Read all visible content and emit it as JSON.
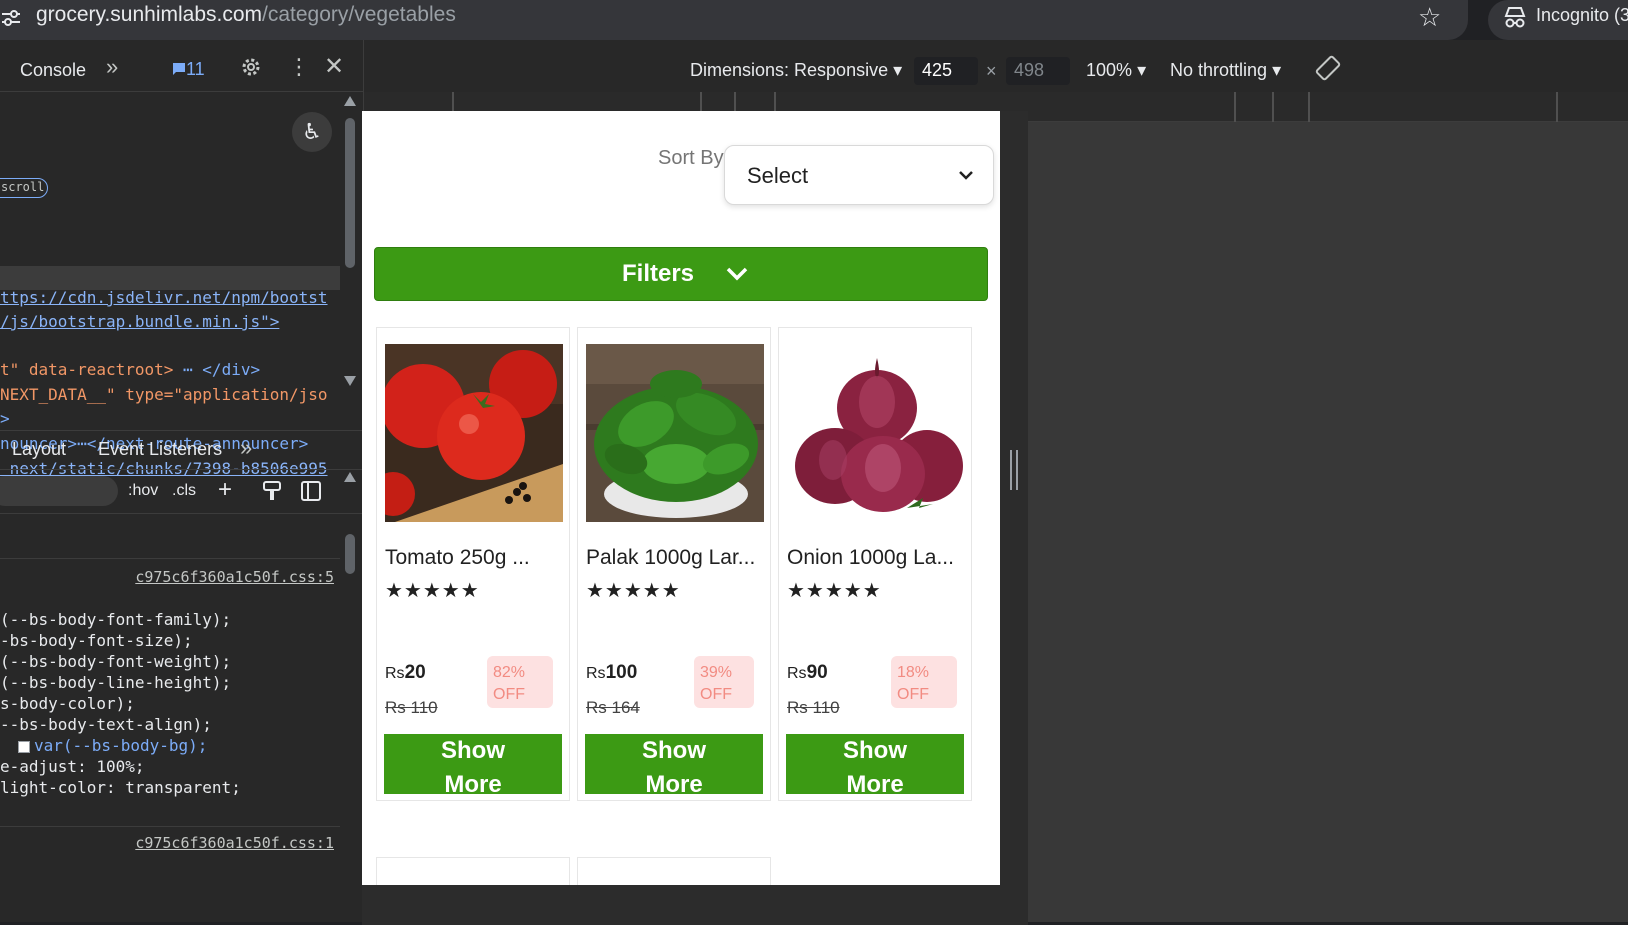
{
  "browser": {
    "url_host": "grocery.sunhimlabs.com",
    "url_path": "/category/vegetables",
    "incognito_label": "Incognito (3"
  },
  "devtools": {
    "console_tab": "Console",
    "message_count": "11",
    "elements_lines": [
      {
        "text": "ttps://cdn.jsdelivr.net/npm/bootst",
        "kind": "link"
      },
      {
        "text": "/js/bootstrap.bundle.min.js\">",
        "kind": "link"
      },
      {
        "text": "t\" data-reactroot>",
        "kind": "blue",
        "tail": "</div>"
      },
      {
        "text": "NEXT_DATA__\" type=\"application/jso",
        "kind": "orange"
      },
      {
        "text": ">",
        "kind": "blue"
      },
      {
        "text": "nouncer>",
        "kind": "blue",
        "tail": "</next-route-announcer>"
      },
      {
        "text": "_next/static/chunks/7398-b8506e995",
        "kind": "link"
      }
    ],
    "scroll_badge": "scroll",
    "styles_tabs": [
      "Layout",
      "Event Listeners"
    ],
    "hov": ":hov",
    "cls": ".cls",
    "css_source_1": "c975c6f360a1c50f.css:5",
    "css_lines": [
      {
        "text": "(--bs-body-font-family);"
      },
      {
        "text": "-bs-body-font-size);"
      },
      {
        "text": "(--bs-body-font-weight);"
      },
      {
        "text": "(--bs-body-line-height);"
      },
      {
        "text": "s-body-color);"
      },
      {
        "text": "--bs-body-text-align);"
      },
      {
        "text": "var(--bs-body-bg);"
      },
      {
        "text": "e-adjust: 100%;"
      },
      {
        "text": "light-color: transparent;"
      }
    ],
    "css_source_2": "c975c6f360a1c50f.css:1"
  },
  "device_toolbar": {
    "dimensions_label": "Dimensions: Responsive",
    "width": "425",
    "height": "498",
    "zoom": "100%",
    "throttling": "No throttling"
  },
  "page": {
    "sort_label": "Sort By",
    "sort_value": "Select",
    "filters_label": "Filters",
    "brand_green": "#3c9a14",
    "products": [
      {
        "name": "Tomato 250g ...",
        "stars": "★★★★★",
        "price_cur": "Rs",
        "price": "20",
        "mrp": "Rs 110",
        "discount_pct": "82%",
        "discount_off": "OFF",
        "image": "tomato-image"
      },
      {
        "name": "Palak 1000g Lar...",
        "stars": "★★★★★",
        "price_cur": "Rs",
        "price": "100",
        "mrp": "Rs 164",
        "discount_pct": "39%",
        "discount_off": "OFF",
        "image": "spinach-image"
      },
      {
        "name": "Onion 1000g La...",
        "stars": "★★★★★",
        "price_cur": "Rs",
        "price": "90",
        "mrp": "Rs 110",
        "discount_pct": "18%",
        "discount_off": "OFF",
        "image": "onion-image"
      }
    ],
    "show_more_line1": "Show",
    "show_more_line2": "More"
  }
}
